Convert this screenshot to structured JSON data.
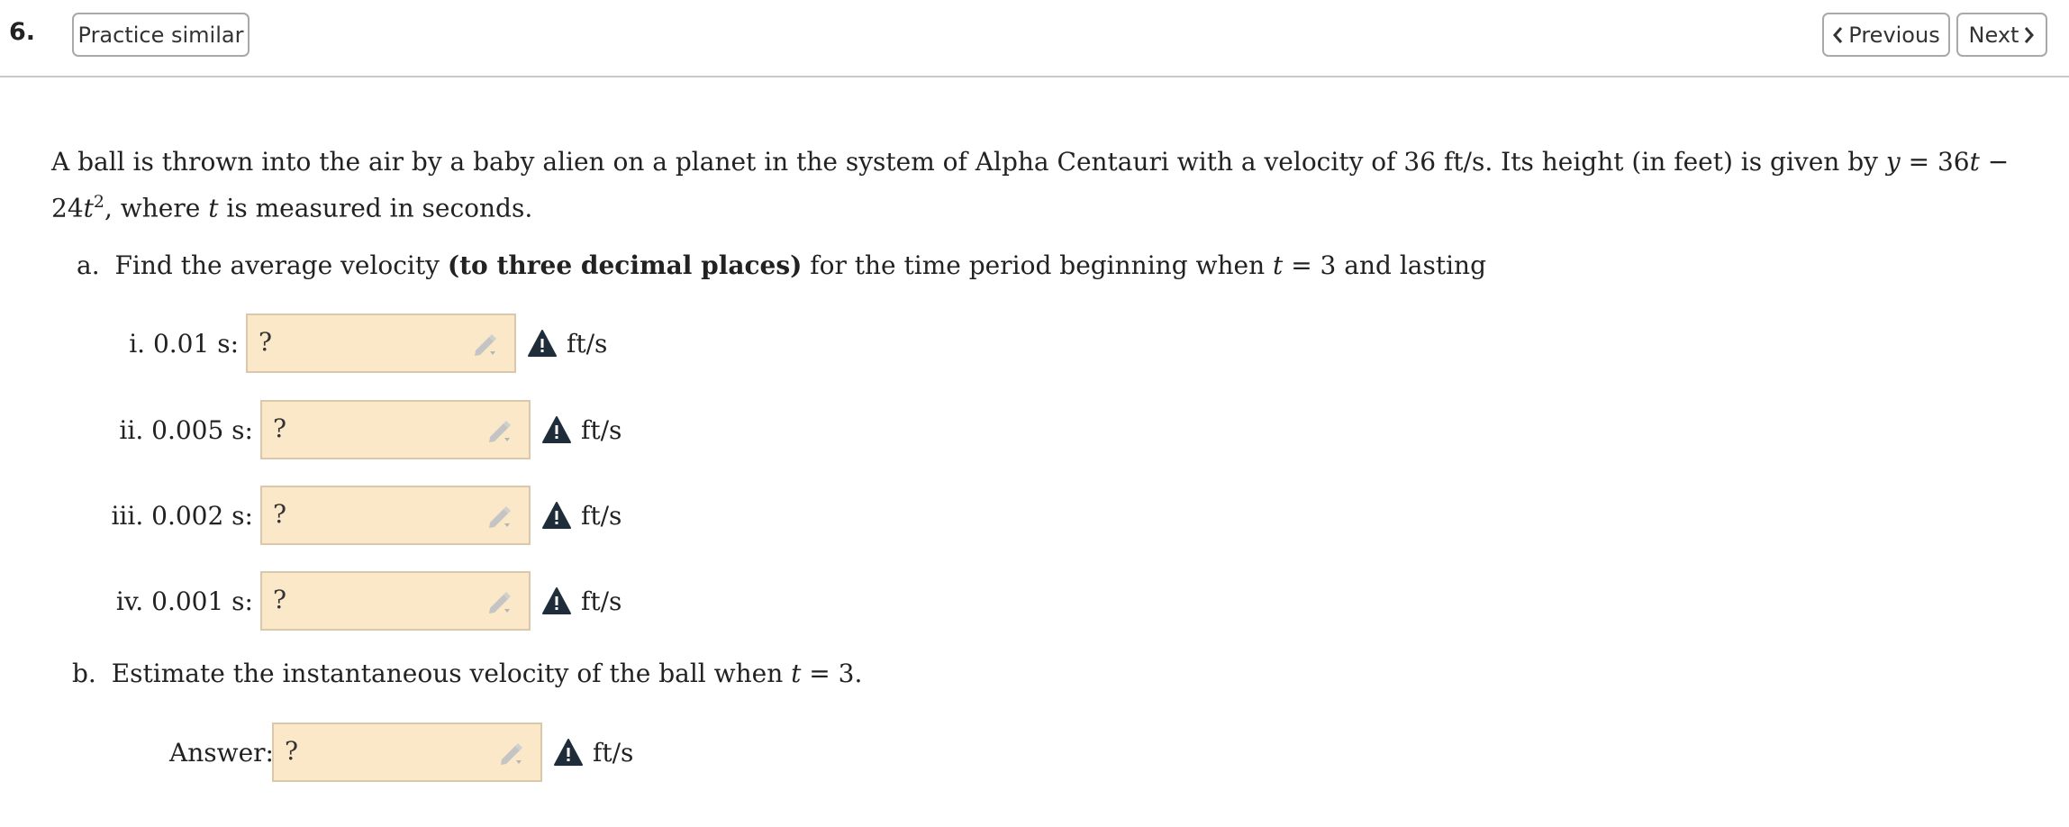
{
  "header": {
    "question_number": "6.",
    "practice_label": "Practice similar",
    "previous_label": "Previous",
    "next_label": "Next"
  },
  "problem": {
    "intro_1": "A ball is thrown into the air by a baby alien on a planet in the system of Alpha Centauri with a velocity of ",
    "velocity": "36 ft/s",
    "intro_2": ". Its height (in feet) is given by ",
    "eq_y": "y",
    "eq_mid": " = 36",
    "eq_t1": "t",
    "eq_minus": " − 24",
    "eq_t2": "t",
    "eq_exp": "2",
    "intro_3": ", where ",
    "var_t": "t",
    "intro_4": " is measured in seconds."
  },
  "part_a": {
    "marker": "a.",
    "text_1": "Find the average velocity ",
    "bold": "(to three decimal places)",
    "text_2": " for the time period beginning when ",
    "var_t": "t",
    "text_3": " = 3 and lasting",
    "items": [
      {
        "roman": "i.",
        "duration": "0.01 s:",
        "value": "?",
        "unit": "ft/s"
      },
      {
        "roman": "ii.",
        "duration": "0.005 s:",
        "value": "?",
        "unit": "ft/s"
      },
      {
        "roman": "iii.",
        "duration": "0.002 s:",
        "value": "?",
        "unit": "ft/s"
      },
      {
        "roman": "iv.",
        "duration": "0.001 s:",
        "value": "?",
        "unit": "ft/s"
      }
    ]
  },
  "part_b": {
    "marker": "b.",
    "text_1": "Estimate the instantaneous velocity of the ball when ",
    "var_t": "t",
    "text_2": " = 3.",
    "answer_label": "Answer:",
    "value": "?",
    "unit": "ft/s"
  },
  "icons": {
    "pencil": "pencil-dropdown-icon",
    "warning": "warning-triangle-icon",
    "prev": "chevron-left-icon",
    "next": "chevron-right-icon"
  },
  "colors": {
    "answer_bg": "#fbe8c9",
    "answer_border": "#d9c9aa",
    "warning": "#1f2d3a"
  }
}
